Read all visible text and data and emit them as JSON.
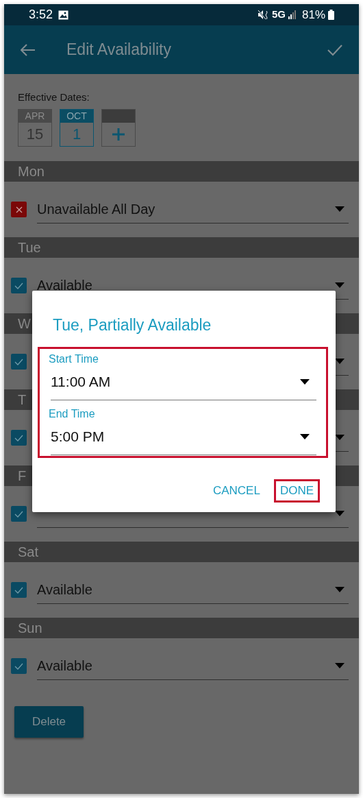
{
  "status_bar": {
    "time": "3:52",
    "network": "5G",
    "battery": "81%"
  },
  "app_bar": {
    "title": "Edit Availability"
  },
  "effective_dates": {
    "label": "Effective Dates:",
    "dates": [
      {
        "month": "APR",
        "day": "15",
        "selected": false
      },
      {
        "month": "OCT",
        "day": "1",
        "selected": true
      }
    ]
  },
  "days": [
    {
      "day": "Mon",
      "available": false,
      "value": "Unavailable All Day"
    },
    {
      "day": "Tue",
      "available": true,
      "value": "Available"
    },
    {
      "day": "W",
      "available": true
    },
    {
      "day": "T",
      "available": true
    },
    {
      "day": "F",
      "available": true
    },
    {
      "day": "Sat",
      "available": true,
      "value": "Available"
    },
    {
      "day": "Sun",
      "available": true,
      "value": "Available"
    }
  ],
  "delete_button": "Delete",
  "dialog": {
    "title": "Tue, Partially Available",
    "fields": [
      {
        "label": "Start Time",
        "value": "11:00 AM"
      },
      {
        "label": "End Time",
        "value": "5:00 PM"
      }
    ],
    "buttons": [
      "CANCEL",
      "DONE"
    ]
  }
}
